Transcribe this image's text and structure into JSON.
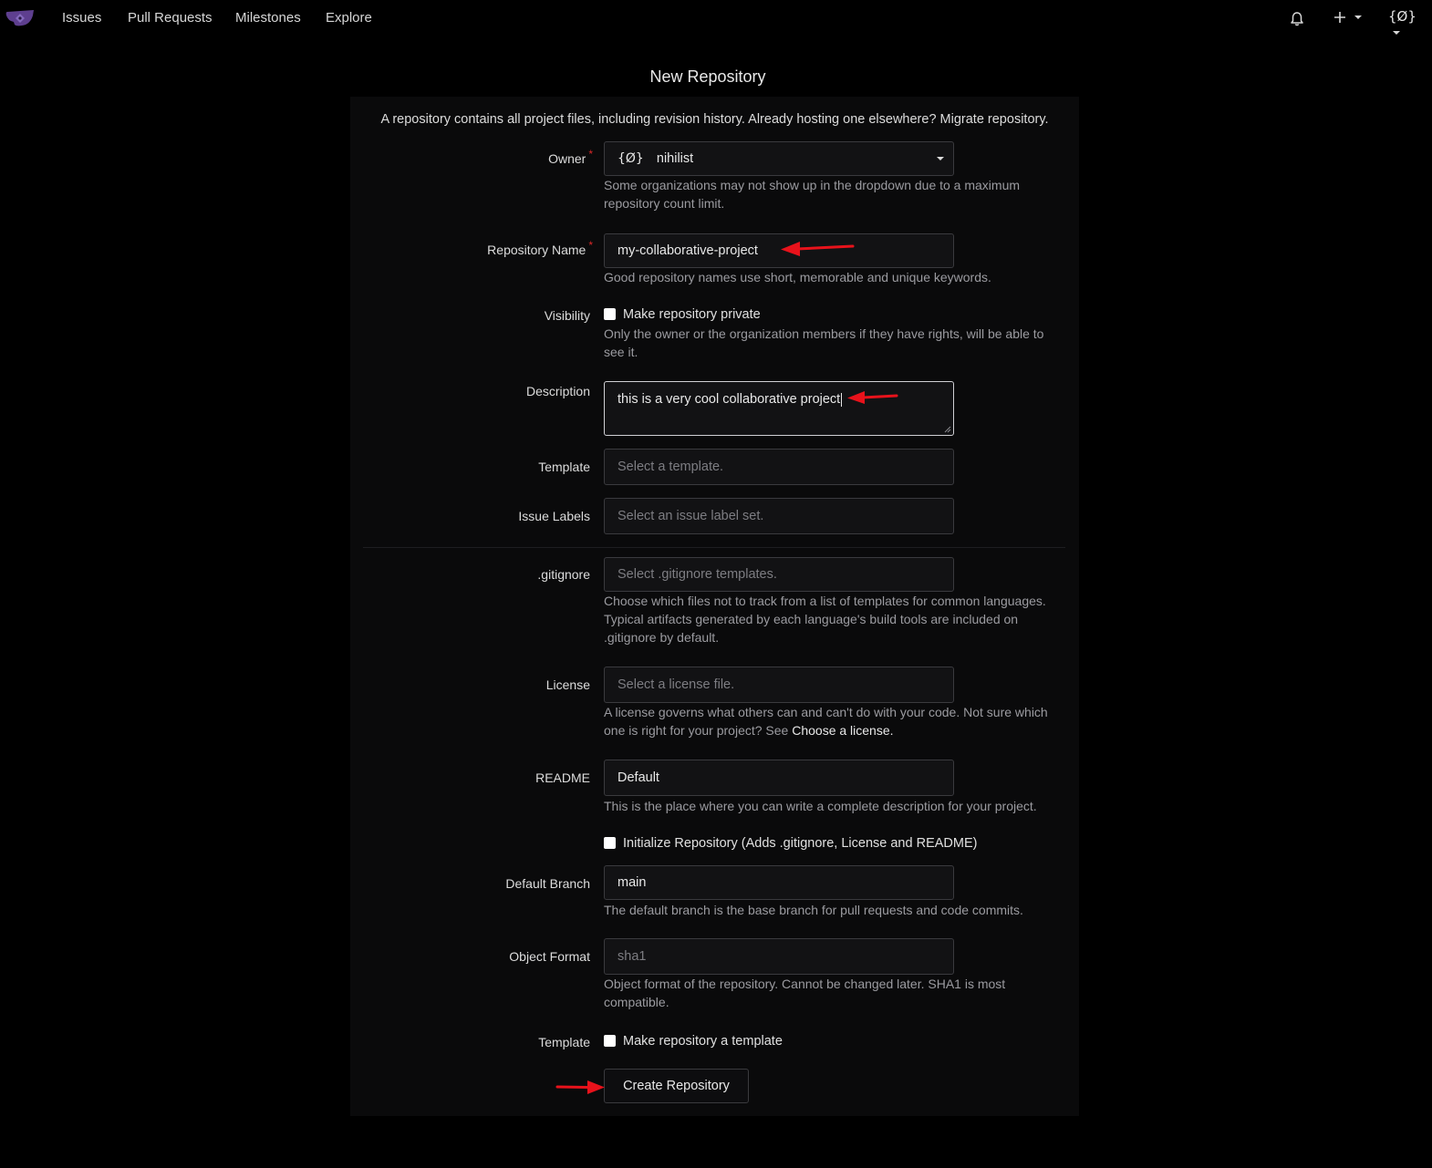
{
  "nav": {
    "logo": "gitea-logo",
    "links": [
      "Issues",
      "Pull Requests",
      "Milestones",
      "Explore"
    ],
    "user_glyph": "{Ø}"
  },
  "page_title": "New Repository",
  "intro": "A repository contains all project files, including revision history. Already hosting one elsewhere? Migrate repository.",
  "owner": {
    "label": "Owner",
    "avatar": "{Ø}",
    "value": "nihilist",
    "help": "Some organizations may not show up in the dropdown due to a maximum repository count limit."
  },
  "repo_name": {
    "label": "Repository Name",
    "value": "my-collaborative-project",
    "help": "Good repository names use short, memorable and unique keywords."
  },
  "visibility": {
    "label": "Visibility",
    "checkbox_label": "Make repository private",
    "help": "Only the owner or the organization members if they have rights, will be able to see it."
  },
  "description": {
    "label": "Description",
    "value": "this is a very cool collaborative project"
  },
  "template": {
    "label": "Template",
    "placeholder": "Select a template."
  },
  "issue_labels": {
    "label": "Issue Labels",
    "placeholder": "Select an issue label set."
  },
  "gitignore": {
    "label": ".gitignore",
    "placeholder": "Select .gitignore templates.",
    "help": "Choose which files not to track from a list of templates for common languages. Typical artifacts generated by each language's build tools are included on .gitignore by default."
  },
  "license": {
    "label": "License",
    "placeholder": "Select a license file.",
    "help": "A license governs what others can and can't do with your code. Not sure which one is right for your project? See",
    "help_link": "Choose a license."
  },
  "readme": {
    "label": "README",
    "value": "Default",
    "help": "This is the place where you can write a complete description for your project."
  },
  "initialize": {
    "checkbox_label": "Initialize Repository (Adds .gitignore, License and README)"
  },
  "default_branch": {
    "label": "Default Branch",
    "value": "main",
    "help": "The default branch is the base branch for pull requests and code commits."
  },
  "object_format": {
    "label": "Object Format",
    "value": "sha1",
    "help": "Object format of the repository. Cannot be changed later. SHA1 is most compatible."
  },
  "template_flag": {
    "label": "Template",
    "checkbox_label": "Make repository a template"
  },
  "create_button": "Create Repository",
  "colors": {
    "background": "#000000",
    "panel": "#0a0a0b",
    "input_bg": "#121214",
    "required": "#db2828",
    "annotation_arrow": "#e8121b"
  }
}
